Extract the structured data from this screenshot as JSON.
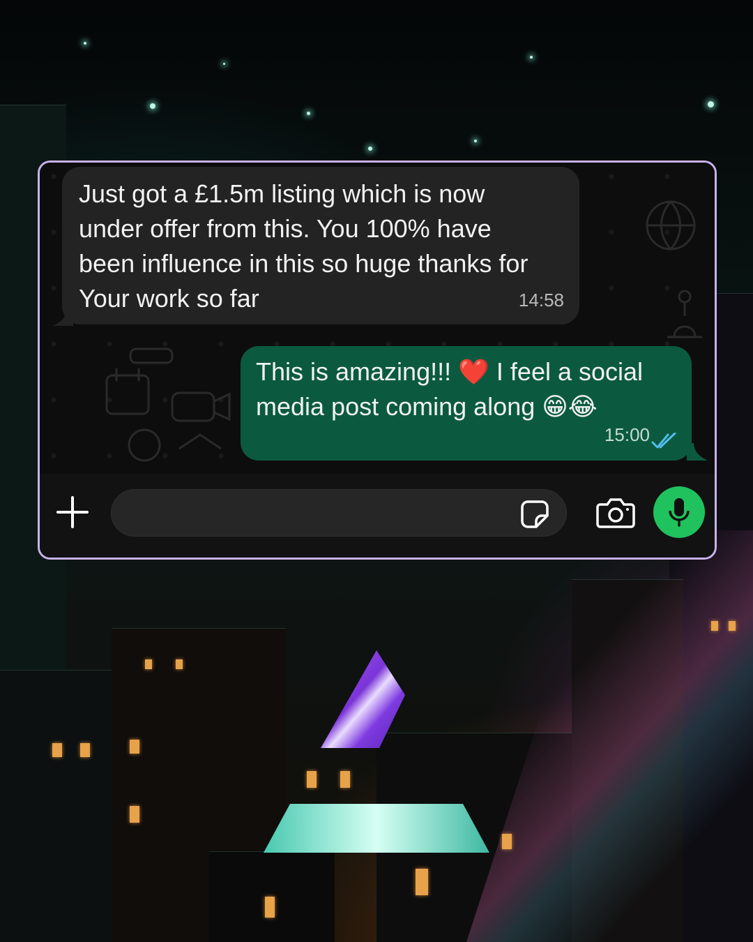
{
  "colors": {
    "frame_border": "#c9b2ec",
    "incoming_bubble": "#232323",
    "outgoing_bubble": "#0b5a40",
    "mic_button": "#20c25e",
    "read_ticks": "#53bdeb"
  },
  "chat": {
    "messages": [
      {
        "direction": "incoming",
        "text": "Just got a £1.5m listing which is now\nunder offer from this. You 100% have\nbeen influence in this so huge thanks for\nYour work so far",
        "time": "14:58"
      },
      {
        "direction": "outgoing",
        "text": "This is amazing!!! ❤️ I feel a social\nmedia post coming along 😁😂",
        "time": "15:00",
        "status_icon": "double-check-read-icon"
      }
    ]
  },
  "composer": {
    "add_icon": "plus-icon",
    "input_value": "",
    "sticker_icon": "sticker-icon",
    "camera_icon": "camera-icon",
    "mic_icon": "microphone-icon"
  },
  "branding": {
    "logo_icon": "triangle-prism-logo"
  }
}
